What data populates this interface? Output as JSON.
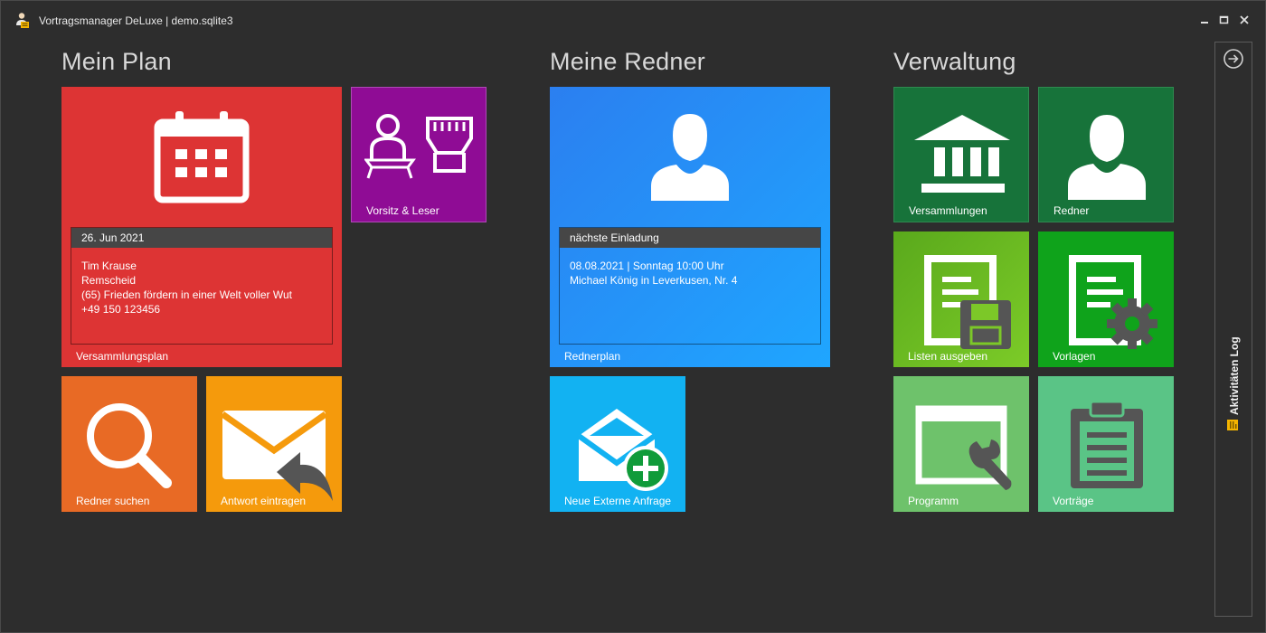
{
  "window": {
    "title": "Vortragsmanager DeLuxe | demo.sqlite3"
  },
  "sections": {
    "mein_plan": "Mein Plan",
    "meine_redner": "Meine Redner",
    "verwaltung": "Verwaltung"
  },
  "tiles": {
    "versammlungsplan": {
      "label": "Versammlungsplan",
      "date": "26. Jun 2021",
      "lines": [
        "Tim Krause",
        "Remscheid",
        "(65) Frieden fördern in einer Welt voller Wut",
        "+49 150 123456"
      ],
      "color": "#dd3434"
    },
    "vorsitz": {
      "label": "Vorsitz & Leser",
      "color": "#8f0c95"
    },
    "redner_suchen": {
      "label": "Redner suchen",
      "color": "#e86a25"
    },
    "antwort": {
      "label": "Antwort eintragen",
      "color": "#f59a0c"
    },
    "rednerplan": {
      "label": "Rednerplan",
      "header": "nächste Einladung",
      "lines": [
        "08.08.2021 | Sonntag 10:00 Uhr",
        "Michael König in Leverkusen, Nr. 4"
      ],
      "color": "#2392f2"
    },
    "externe_anfrage": {
      "label": "Neue Externe Anfrage",
      "color": "#12b2f2"
    },
    "versammlungen": {
      "label": "Versammlungen",
      "color": "#17733a"
    },
    "redner": {
      "label": "Redner",
      "color": "#17733a"
    },
    "listen": {
      "label": "Listen ausgeben",
      "color": "#6dbb20"
    },
    "vorlagen": {
      "label": "Vorlagen",
      "color": "#0fa31b"
    },
    "programm": {
      "label": "Programm",
      "color": "#6ec26b"
    },
    "vortraege": {
      "label": "Vorträge",
      "color": "#5ac486"
    }
  },
  "sidepanel": {
    "log_label": "Aktivitäten Log",
    "arrow_icon": "arrow-right-circle-icon"
  }
}
